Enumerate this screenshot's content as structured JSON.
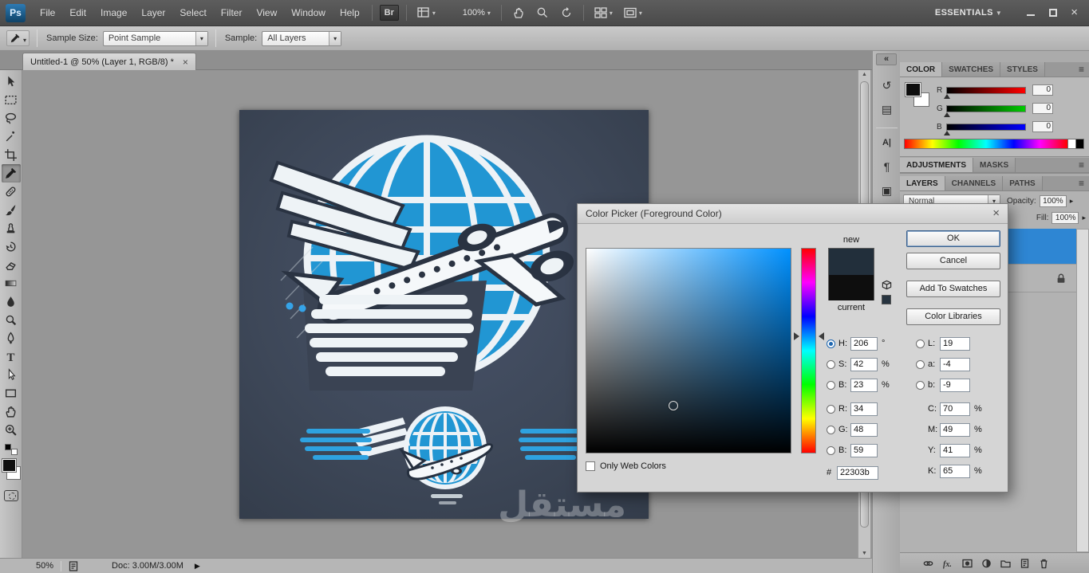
{
  "palette": {
    "accent_blue": "#2ea2e0",
    "globe_blue": "#2196d3",
    "artwork_background": "#3e4859"
  },
  "menubar": {
    "logo": "Ps",
    "items": [
      "File",
      "Edit",
      "Image",
      "Layer",
      "Select",
      "Filter",
      "View",
      "Window",
      "Help"
    ],
    "bridge": "Br",
    "zoom": "100%",
    "workspace": "ESSENTIALS"
  },
  "options_bar": {
    "sample_size_label": "Sample Size:",
    "sample_size_value": "Point Sample",
    "sample_label": "Sample:",
    "sample_value": "All Layers"
  },
  "document": {
    "tab_title": "Untitled-1 @ 50% (Layer 1, RGB/8) *",
    "close_glyph": "×"
  },
  "tools": [
    "move",
    "rectangular-marquee",
    "lasso",
    "quick-selection",
    "crop",
    "eyedropper",
    "spot-healing",
    "brush",
    "clone-stamp",
    "history-brush",
    "eraser",
    "gradient",
    "blur",
    "dodge",
    "pen",
    "type",
    "path-selection",
    "rectangle",
    "hand",
    "zoom"
  ],
  "icon_strip": {
    "expand_glyph": "«"
  },
  "color_picker": {
    "title": "Color Picker (Foreground Color)",
    "new_label": "new",
    "current_label": "current",
    "ok": "OK",
    "cancel": "Cancel",
    "add_to_swatches": "Add To Swatches",
    "color_libraries": "Color Libraries",
    "only_web_colors": "Only Web Colors",
    "hex_prefix": "#",
    "hex": "22303b",
    "new_color": "#222f3b",
    "current_color": "#0e0e0e",
    "web_swatch_color": "#273440",
    "h_label": "H:",
    "h": "206",
    "h_unit": "°",
    "s_label": "S:",
    "s": "42",
    "s_unit": "%",
    "bb_label": "B:",
    "bb": "23",
    "bb_unit": "%",
    "r_label": "R:",
    "r": "34",
    "g_label": "G:",
    "g": "48",
    "b_label": "B:",
    "b": "59",
    "l_label": "L:",
    "l": "19",
    "a_label": "a:",
    "a": "-4",
    "lab_b_label": "b:",
    "lab_b": "-9",
    "c_label": "C:",
    "c": "70",
    "m_label": "M:",
    "m": "49",
    "y_label": "Y:",
    "y": "41",
    "k_label": "K:",
    "k": "65",
    "cmyk_unit": "%"
  },
  "right_dock": {
    "color_tabs": [
      "COLOR",
      "SWATCHES",
      "STYLES"
    ],
    "sliders": [
      {
        "label": "R",
        "value": "0"
      },
      {
        "label": "G",
        "value": "0"
      },
      {
        "label": "B",
        "value": "0"
      }
    ],
    "adjustments_tabs": [
      "ADJUSTMENTS",
      "MASKS"
    ],
    "layers_tabs": [
      "LAYERS",
      "CHANNELS",
      "PATHS"
    ],
    "blend_mode": "Normal",
    "opacity_label": "Opacity:",
    "opacity": "100%",
    "fill_label": "Fill:",
    "fill": "100%",
    "selected_layer_color": "#2e86d3"
  },
  "statusbar": {
    "zoom": "50%",
    "doc": "Doc: 3.00M/3.00M",
    "flyout_glyph": "▶"
  },
  "artwork": {
    "watermark": "مستقل"
  }
}
